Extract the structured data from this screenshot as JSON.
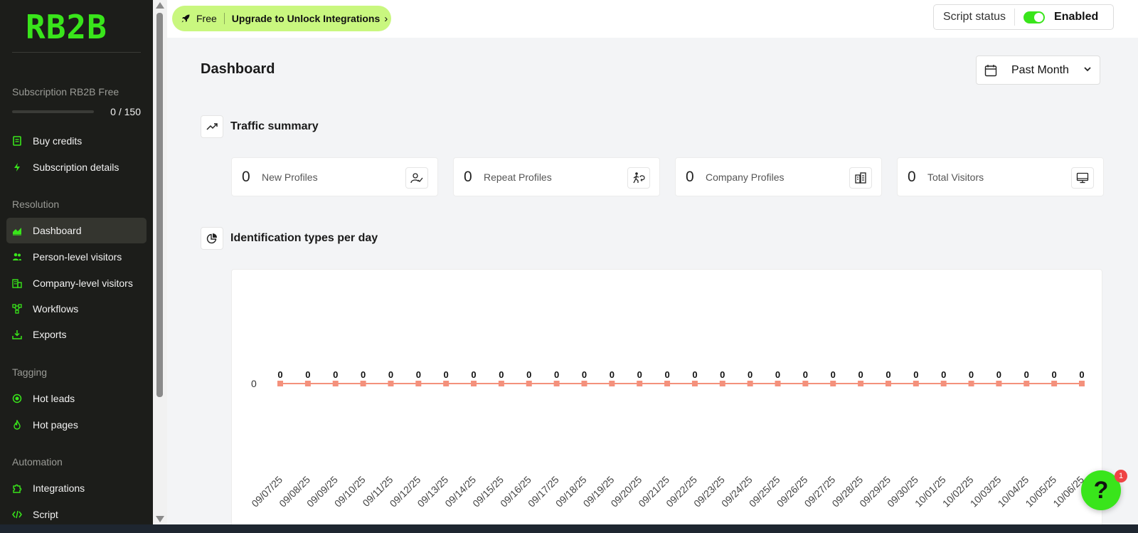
{
  "sidebar": {
    "logo": "RB2B",
    "subscription_label": "Subscription RB2B Free",
    "credits_used": 0,
    "credits_total": 150,
    "credits_text": "0 / 150",
    "top_items": [
      {
        "label": "Buy credits",
        "icon": "receipt-icon"
      },
      {
        "label": "Subscription details",
        "icon": "bolt-icon"
      }
    ],
    "sections": [
      {
        "title": "Resolution",
        "items": [
          {
            "label": "Dashboard",
            "icon": "chart-area-icon",
            "active": true
          },
          {
            "label": "Person-level visitors",
            "icon": "users-icon"
          },
          {
            "label": "Company-level visitors",
            "icon": "building-icon"
          },
          {
            "label": "Workflows",
            "icon": "workflow-icon"
          },
          {
            "label": "Exports",
            "icon": "download-icon"
          }
        ]
      },
      {
        "title": "Tagging",
        "items": [
          {
            "label": "Hot leads",
            "icon": "target-icon"
          },
          {
            "label": "Hot pages",
            "icon": "flame-icon"
          }
        ]
      },
      {
        "title": "Automation",
        "items": [
          {
            "label": "Integrations",
            "icon": "puzzle-icon"
          },
          {
            "label": "Script",
            "icon": "code-icon"
          }
        ]
      }
    ],
    "accent_color": "#39e51b"
  },
  "topbar": {
    "plan_label": "Free",
    "upgrade_label": "Upgrade to Unlock Integrations",
    "script_status_label": "Script status",
    "script_enabled": true,
    "script_state_label": "Enabled"
  },
  "main": {
    "title": "Dashboard",
    "date_range": "Past Month",
    "traffic_title": "Traffic summary",
    "stats": [
      {
        "value": "0",
        "label": "New Profiles",
        "icon": "user-check-icon"
      },
      {
        "value": "0",
        "label": "Repeat Profiles",
        "icon": "repeat-user-icon"
      },
      {
        "value": "0",
        "label": "Company Profiles",
        "icon": "buildings-icon"
      },
      {
        "value": "0",
        "label": "Total Visitors",
        "icon": "monitor-icon"
      }
    ],
    "identification_title": "Identification types per day"
  },
  "chart_data": {
    "type": "line",
    "x": [
      "09/07/25",
      "09/08/25",
      "09/09/25",
      "09/10/25",
      "09/11/25",
      "09/12/25",
      "09/13/25",
      "09/14/25",
      "09/15/25",
      "09/16/25",
      "09/17/25",
      "09/18/25",
      "09/19/25",
      "09/20/25",
      "09/21/25",
      "09/22/25",
      "09/23/25",
      "09/24/25",
      "09/25/25",
      "09/26/25",
      "09/27/25",
      "09/28/25",
      "09/29/25",
      "09/30/25",
      "10/01/25",
      "10/02/25",
      "10/03/25",
      "10/04/25",
      "10/05/25",
      "10/06/25"
    ],
    "series": [
      {
        "values": [
          0,
          0,
          0,
          0,
          0,
          0,
          0,
          0,
          0,
          0,
          0,
          0,
          0,
          0,
          0,
          0,
          0,
          0,
          0,
          0,
          0,
          0,
          0,
          0,
          0,
          0,
          0,
          0,
          0,
          0
        ],
        "color": "#f4917c"
      }
    ],
    "y_ticks": [
      "0"
    ],
    "data_labels": true,
    "grid": false
  },
  "help": {
    "label": "?",
    "badge": "1",
    "color": "#39e51b"
  }
}
